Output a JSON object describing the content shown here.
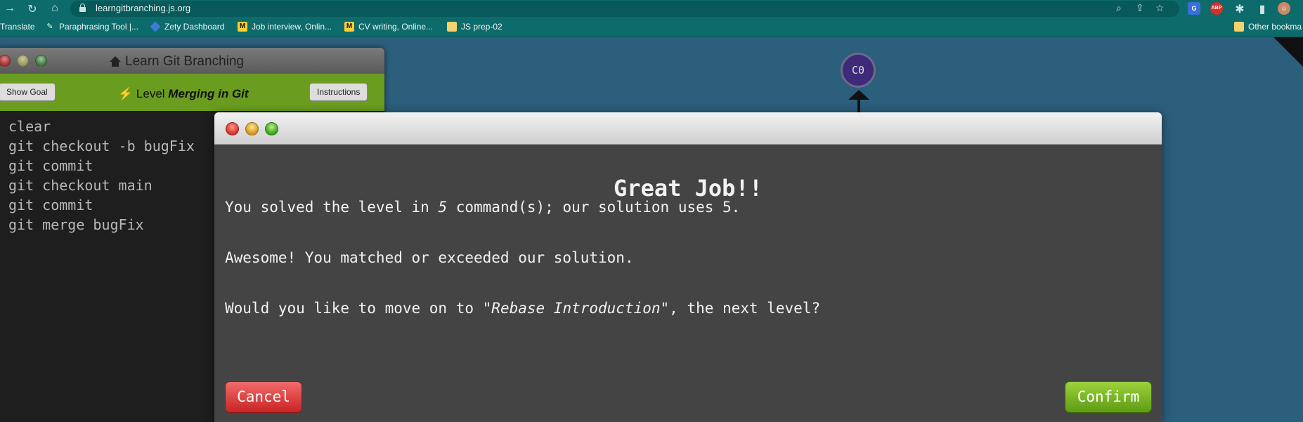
{
  "browser": {
    "url": "learngitbranching.js.org",
    "bookmarks": [
      {
        "label": "Translate",
        "icon": "none"
      },
      {
        "label": "Paraphrasing Tool |...",
        "icon": "paraphrase-icon"
      },
      {
        "label": "Zety Dashboard",
        "icon": "zety-icon"
      },
      {
        "label": "Job interview, Onlin...",
        "icon": "miro-icon"
      },
      {
        "label": "CV writing, Online...",
        "icon": "miro-icon"
      },
      {
        "label": "JS prep-02",
        "icon": "folder-icon"
      },
      {
        "label": "Other bookma",
        "icon": "folder-icon"
      }
    ],
    "extensions": [
      "google-translate-icon",
      "adblock-plus-icon",
      "puzzle-icon",
      "sidebar-icon",
      "profile-avatar"
    ]
  },
  "terminal": {
    "title": "Learn Git Branching",
    "show_goal": "Show Goal",
    "level_prefix": "Level",
    "level_name": "Merging in Git",
    "instructions": "Instructions",
    "lines": [
      "clear",
      "git checkout -b bugFix",
      "git commit",
      "git checkout main",
      "git commit",
      "git merge bugFix"
    ]
  },
  "graph": {
    "commit_label": "C0",
    "commit_color": "#3f2a7a"
  },
  "modal": {
    "heading": "Great Job!!",
    "line1_a": "You solved the level in ",
    "line1_count": "5",
    "line1_b": " command(s); our solution uses 5.",
    "line2": "Awesome! You matched or exceeded our solution.",
    "line3_a": "Would you like to move on to ",
    "line3_level": "\"Rebase Introduction\"",
    "line3_b": ", the next level?",
    "cancel": "Cancel",
    "confirm": "Confirm"
  },
  "colors": {
    "chrome": "#0d6b6b",
    "background": "#2c5f7c",
    "level_bar": "#6a9d1f",
    "cancel": "#d93434",
    "confirm": "#7ab828"
  }
}
